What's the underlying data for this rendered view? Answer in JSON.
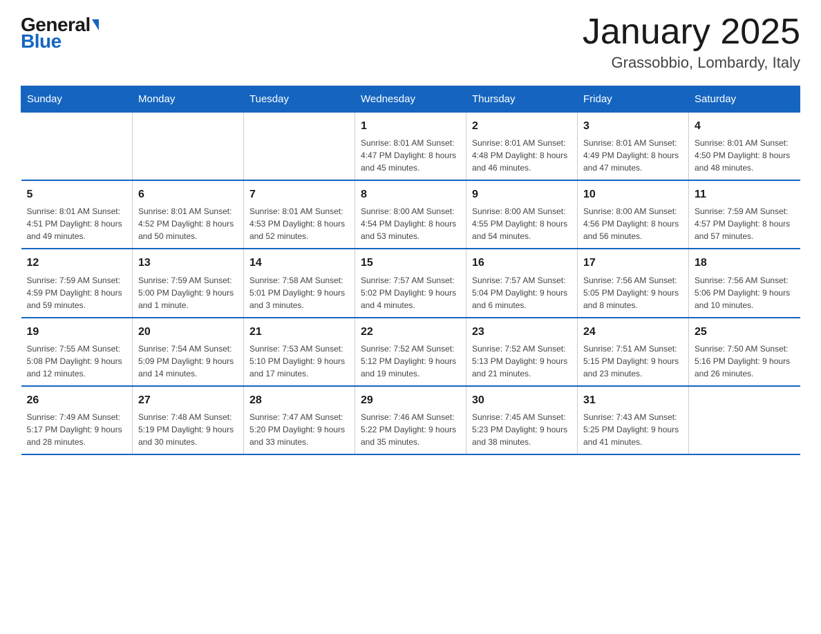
{
  "logo": {
    "general": "General",
    "blue": "Blue"
  },
  "header": {
    "month": "January 2025",
    "location": "Grassobbio, Lombardy, Italy"
  },
  "days_of_week": [
    "Sunday",
    "Monday",
    "Tuesday",
    "Wednesday",
    "Thursday",
    "Friday",
    "Saturday"
  ],
  "weeks": [
    [
      {
        "num": "",
        "info": ""
      },
      {
        "num": "",
        "info": ""
      },
      {
        "num": "",
        "info": ""
      },
      {
        "num": "1",
        "info": "Sunrise: 8:01 AM\nSunset: 4:47 PM\nDaylight: 8 hours\nand 45 minutes."
      },
      {
        "num": "2",
        "info": "Sunrise: 8:01 AM\nSunset: 4:48 PM\nDaylight: 8 hours\nand 46 minutes."
      },
      {
        "num": "3",
        "info": "Sunrise: 8:01 AM\nSunset: 4:49 PM\nDaylight: 8 hours\nand 47 minutes."
      },
      {
        "num": "4",
        "info": "Sunrise: 8:01 AM\nSunset: 4:50 PM\nDaylight: 8 hours\nand 48 minutes."
      }
    ],
    [
      {
        "num": "5",
        "info": "Sunrise: 8:01 AM\nSunset: 4:51 PM\nDaylight: 8 hours\nand 49 minutes."
      },
      {
        "num": "6",
        "info": "Sunrise: 8:01 AM\nSunset: 4:52 PM\nDaylight: 8 hours\nand 50 minutes."
      },
      {
        "num": "7",
        "info": "Sunrise: 8:01 AM\nSunset: 4:53 PM\nDaylight: 8 hours\nand 52 minutes."
      },
      {
        "num": "8",
        "info": "Sunrise: 8:00 AM\nSunset: 4:54 PM\nDaylight: 8 hours\nand 53 minutes."
      },
      {
        "num": "9",
        "info": "Sunrise: 8:00 AM\nSunset: 4:55 PM\nDaylight: 8 hours\nand 54 minutes."
      },
      {
        "num": "10",
        "info": "Sunrise: 8:00 AM\nSunset: 4:56 PM\nDaylight: 8 hours\nand 56 minutes."
      },
      {
        "num": "11",
        "info": "Sunrise: 7:59 AM\nSunset: 4:57 PM\nDaylight: 8 hours\nand 57 minutes."
      }
    ],
    [
      {
        "num": "12",
        "info": "Sunrise: 7:59 AM\nSunset: 4:59 PM\nDaylight: 8 hours\nand 59 minutes."
      },
      {
        "num": "13",
        "info": "Sunrise: 7:59 AM\nSunset: 5:00 PM\nDaylight: 9 hours\nand 1 minute."
      },
      {
        "num": "14",
        "info": "Sunrise: 7:58 AM\nSunset: 5:01 PM\nDaylight: 9 hours\nand 3 minutes."
      },
      {
        "num": "15",
        "info": "Sunrise: 7:57 AM\nSunset: 5:02 PM\nDaylight: 9 hours\nand 4 minutes."
      },
      {
        "num": "16",
        "info": "Sunrise: 7:57 AM\nSunset: 5:04 PM\nDaylight: 9 hours\nand 6 minutes."
      },
      {
        "num": "17",
        "info": "Sunrise: 7:56 AM\nSunset: 5:05 PM\nDaylight: 9 hours\nand 8 minutes."
      },
      {
        "num": "18",
        "info": "Sunrise: 7:56 AM\nSunset: 5:06 PM\nDaylight: 9 hours\nand 10 minutes."
      }
    ],
    [
      {
        "num": "19",
        "info": "Sunrise: 7:55 AM\nSunset: 5:08 PM\nDaylight: 9 hours\nand 12 minutes."
      },
      {
        "num": "20",
        "info": "Sunrise: 7:54 AM\nSunset: 5:09 PM\nDaylight: 9 hours\nand 14 minutes."
      },
      {
        "num": "21",
        "info": "Sunrise: 7:53 AM\nSunset: 5:10 PM\nDaylight: 9 hours\nand 17 minutes."
      },
      {
        "num": "22",
        "info": "Sunrise: 7:52 AM\nSunset: 5:12 PM\nDaylight: 9 hours\nand 19 minutes."
      },
      {
        "num": "23",
        "info": "Sunrise: 7:52 AM\nSunset: 5:13 PM\nDaylight: 9 hours\nand 21 minutes."
      },
      {
        "num": "24",
        "info": "Sunrise: 7:51 AM\nSunset: 5:15 PM\nDaylight: 9 hours\nand 23 minutes."
      },
      {
        "num": "25",
        "info": "Sunrise: 7:50 AM\nSunset: 5:16 PM\nDaylight: 9 hours\nand 26 minutes."
      }
    ],
    [
      {
        "num": "26",
        "info": "Sunrise: 7:49 AM\nSunset: 5:17 PM\nDaylight: 9 hours\nand 28 minutes."
      },
      {
        "num": "27",
        "info": "Sunrise: 7:48 AM\nSunset: 5:19 PM\nDaylight: 9 hours\nand 30 minutes."
      },
      {
        "num": "28",
        "info": "Sunrise: 7:47 AM\nSunset: 5:20 PM\nDaylight: 9 hours\nand 33 minutes."
      },
      {
        "num": "29",
        "info": "Sunrise: 7:46 AM\nSunset: 5:22 PM\nDaylight: 9 hours\nand 35 minutes."
      },
      {
        "num": "30",
        "info": "Sunrise: 7:45 AM\nSunset: 5:23 PM\nDaylight: 9 hours\nand 38 minutes."
      },
      {
        "num": "31",
        "info": "Sunrise: 7:43 AM\nSunset: 5:25 PM\nDaylight: 9 hours\nand 41 minutes."
      },
      {
        "num": "",
        "info": ""
      }
    ]
  ]
}
